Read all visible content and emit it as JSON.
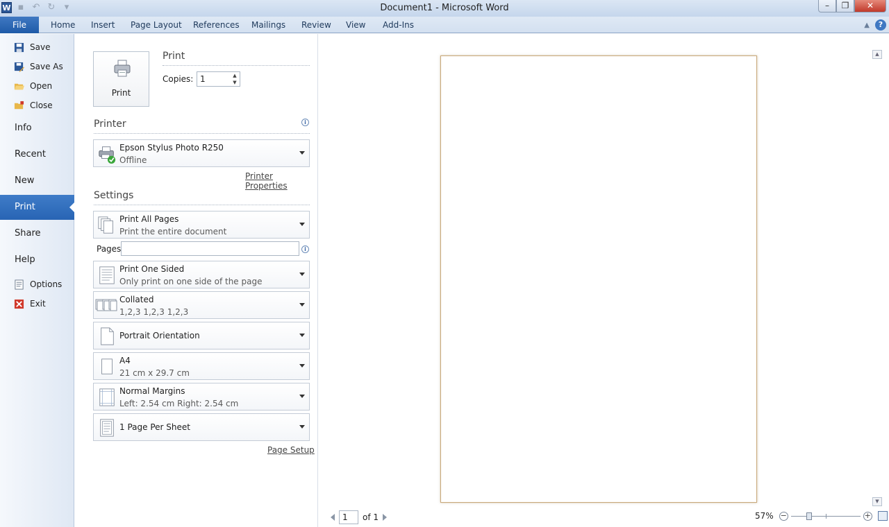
{
  "window": {
    "title": "Document1  -  Microsoft Word",
    "app_icon_letter": "W",
    "minimize_glyph": "–",
    "maximize_glyph": "❐",
    "close_glyph": "✕"
  },
  "ribbon": {
    "file_tab": "File",
    "tabs": [
      "Home",
      "Insert",
      "Page Layout",
      "References",
      "Mailings",
      "Review",
      "View",
      "Add-Ins"
    ],
    "help_glyph": "?"
  },
  "nav": {
    "small_top": [
      {
        "label": "Save",
        "icon": "save-icon"
      },
      {
        "label": "Save As",
        "icon": "save-as-icon"
      },
      {
        "label": "Open",
        "icon": "open-folder-icon"
      },
      {
        "label": "Close",
        "icon": "close-folder-icon"
      }
    ],
    "large": [
      "Info",
      "Recent",
      "New",
      "Print",
      "Share",
      "Help"
    ],
    "active": "Print",
    "small_bottom": [
      {
        "label": "Options",
        "icon": "options-icon"
      },
      {
        "label": "Exit",
        "icon": "exit-icon"
      }
    ]
  },
  "print": {
    "section_title": "Print",
    "button_label": "Print",
    "copies_label": "Copies:",
    "copies_value": "1"
  },
  "printer": {
    "section_title": "Printer",
    "name": "Epson Stylus Photo R250",
    "status": "Offline",
    "properties_link": "Printer Properties"
  },
  "settings": {
    "section_title": "Settings",
    "pages_label": "Pages:",
    "pages_value": "",
    "items": [
      {
        "main": "Print All Pages",
        "sub": "Print the entire document",
        "icon": "pages-stack-icon"
      },
      {
        "main": "Print One Sided",
        "sub": "Only print on one side of the page",
        "icon": "one-sided-icon"
      },
      {
        "main": "Collated",
        "sub": "1,2,3    1,2,3    1,2,3",
        "icon": "collated-icon"
      },
      {
        "main": "Portrait Orientation",
        "sub": "",
        "icon": "portrait-icon"
      },
      {
        "main": "A4",
        "sub": "21 cm x 29.7 cm",
        "icon": "paper-size-icon"
      },
      {
        "main": "Normal Margins",
        "sub": "Left:  2.54 cm    Right:  2.54 cm",
        "icon": "margins-icon"
      },
      {
        "main": "1 Page Per Sheet",
        "sub": "",
        "icon": "pages-per-sheet-icon"
      }
    ],
    "page_setup_link": "Page Setup"
  },
  "preview": {
    "current_page": "1",
    "total_pages": "of 1",
    "zoom_label": "57%",
    "zoom_fraction": 0.57
  },
  "colors": {
    "accent": "#2864b4",
    "sheet_border": "#c9a97a"
  }
}
